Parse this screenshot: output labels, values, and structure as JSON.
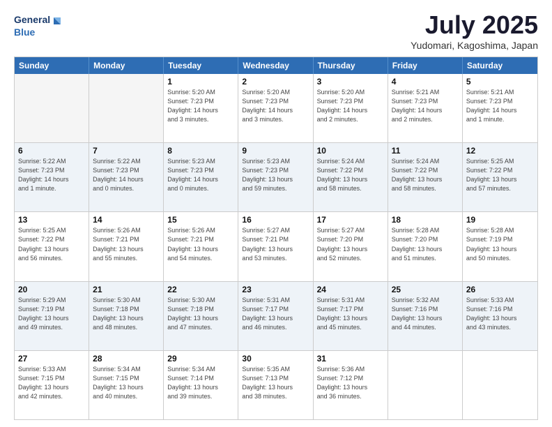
{
  "logo": {
    "line1": "General",
    "line2": "Blue"
  },
  "title": "July 2025",
  "subtitle": "Yudomari, Kagoshima, Japan",
  "header": {
    "days": [
      "Sunday",
      "Monday",
      "Tuesday",
      "Wednesday",
      "Thursday",
      "Friday",
      "Saturday"
    ]
  },
  "rows": [
    {
      "cells": [
        {
          "empty": true
        },
        {
          "empty": true
        },
        {
          "day": "1",
          "info": "Sunrise: 5:20 AM\nSunset: 7:23 PM\nDaylight: 14 hours\nand 3 minutes."
        },
        {
          "day": "2",
          "info": "Sunrise: 5:20 AM\nSunset: 7:23 PM\nDaylight: 14 hours\nand 3 minutes."
        },
        {
          "day": "3",
          "info": "Sunrise: 5:20 AM\nSunset: 7:23 PM\nDaylight: 14 hours\nand 2 minutes."
        },
        {
          "day": "4",
          "info": "Sunrise: 5:21 AM\nSunset: 7:23 PM\nDaylight: 14 hours\nand 2 minutes."
        },
        {
          "day": "5",
          "info": "Sunrise: 5:21 AM\nSunset: 7:23 PM\nDaylight: 14 hours\nand 1 minute."
        }
      ]
    },
    {
      "cells": [
        {
          "day": "6",
          "info": "Sunrise: 5:22 AM\nSunset: 7:23 PM\nDaylight: 14 hours\nand 1 minute."
        },
        {
          "day": "7",
          "info": "Sunrise: 5:22 AM\nSunset: 7:23 PM\nDaylight: 14 hours\nand 0 minutes."
        },
        {
          "day": "8",
          "info": "Sunrise: 5:23 AM\nSunset: 7:23 PM\nDaylight: 14 hours\nand 0 minutes."
        },
        {
          "day": "9",
          "info": "Sunrise: 5:23 AM\nSunset: 7:23 PM\nDaylight: 13 hours\nand 59 minutes."
        },
        {
          "day": "10",
          "info": "Sunrise: 5:24 AM\nSunset: 7:22 PM\nDaylight: 13 hours\nand 58 minutes."
        },
        {
          "day": "11",
          "info": "Sunrise: 5:24 AM\nSunset: 7:22 PM\nDaylight: 13 hours\nand 58 minutes."
        },
        {
          "day": "12",
          "info": "Sunrise: 5:25 AM\nSunset: 7:22 PM\nDaylight: 13 hours\nand 57 minutes."
        }
      ]
    },
    {
      "cells": [
        {
          "day": "13",
          "info": "Sunrise: 5:25 AM\nSunset: 7:22 PM\nDaylight: 13 hours\nand 56 minutes."
        },
        {
          "day": "14",
          "info": "Sunrise: 5:26 AM\nSunset: 7:21 PM\nDaylight: 13 hours\nand 55 minutes."
        },
        {
          "day": "15",
          "info": "Sunrise: 5:26 AM\nSunset: 7:21 PM\nDaylight: 13 hours\nand 54 minutes."
        },
        {
          "day": "16",
          "info": "Sunrise: 5:27 AM\nSunset: 7:21 PM\nDaylight: 13 hours\nand 53 minutes."
        },
        {
          "day": "17",
          "info": "Sunrise: 5:27 AM\nSunset: 7:20 PM\nDaylight: 13 hours\nand 52 minutes."
        },
        {
          "day": "18",
          "info": "Sunrise: 5:28 AM\nSunset: 7:20 PM\nDaylight: 13 hours\nand 51 minutes."
        },
        {
          "day": "19",
          "info": "Sunrise: 5:28 AM\nSunset: 7:19 PM\nDaylight: 13 hours\nand 50 minutes."
        }
      ]
    },
    {
      "cells": [
        {
          "day": "20",
          "info": "Sunrise: 5:29 AM\nSunset: 7:19 PM\nDaylight: 13 hours\nand 49 minutes."
        },
        {
          "day": "21",
          "info": "Sunrise: 5:30 AM\nSunset: 7:18 PM\nDaylight: 13 hours\nand 48 minutes."
        },
        {
          "day": "22",
          "info": "Sunrise: 5:30 AM\nSunset: 7:18 PM\nDaylight: 13 hours\nand 47 minutes."
        },
        {
          "day": "23",
          "info": "Sunrise: 5:31 AM\nSunset: 7:17 PM\nDaylight: 13 hours\nand 46 minutes."
        },
        {
          "day": "24",
          "info": "Sunrise: 5:31 AM\nSunset: 7:17 PM\nDaylight: 13 hours\nand 45 minutes."
        },
        {
          "day": "25",
          "info": "Sunrise: 5:32 AM\nSunset: 7:16 PM\nDaylight: 13 hours\nand 44 minutes."
        },
        {
          "day": "26",
          "info": "Sunrise: 5:33 AM\nSunset: 7:16 PM\nDaylight: 13 hours\nand 43 minutes."
        }
      ]
    },
    {
      "cells": [
        {
          "day": "27",
          "info": "Sunrise: 5:33 AM\nSunset: 7:15 PM\nDaylight: 13 hours\nand 42 minutes."
        },
        {
          "day": "28",
          "info": "Sunrise: 5:34 AM\nSunset: 7:15 PM\nDaylight: 13 hours\nand 40 minutes."
        },
        {
          "day": "29",
          "info": "Sunrise: 5:34 AM\nSunset: 7:14 PM\nDaylight: 13 hours\nand 39 minutes."
        },
        {
          "day": "30",
          "info": "Sunrise: 5:35 AM\nSunset: 7:13 PM\nDaylight: 13 hours\nand 38 minutes."
        },
        {
          "day": "31",
          "info": "Sunrise: 5:36 AM\nSunset: 7:12 PM\nDaylight: 13 hours\nand 36 minutes."
        },
        {
          "empty": true
        },
        {
          "empty": true
        }
      ]
    }
  ]
}
